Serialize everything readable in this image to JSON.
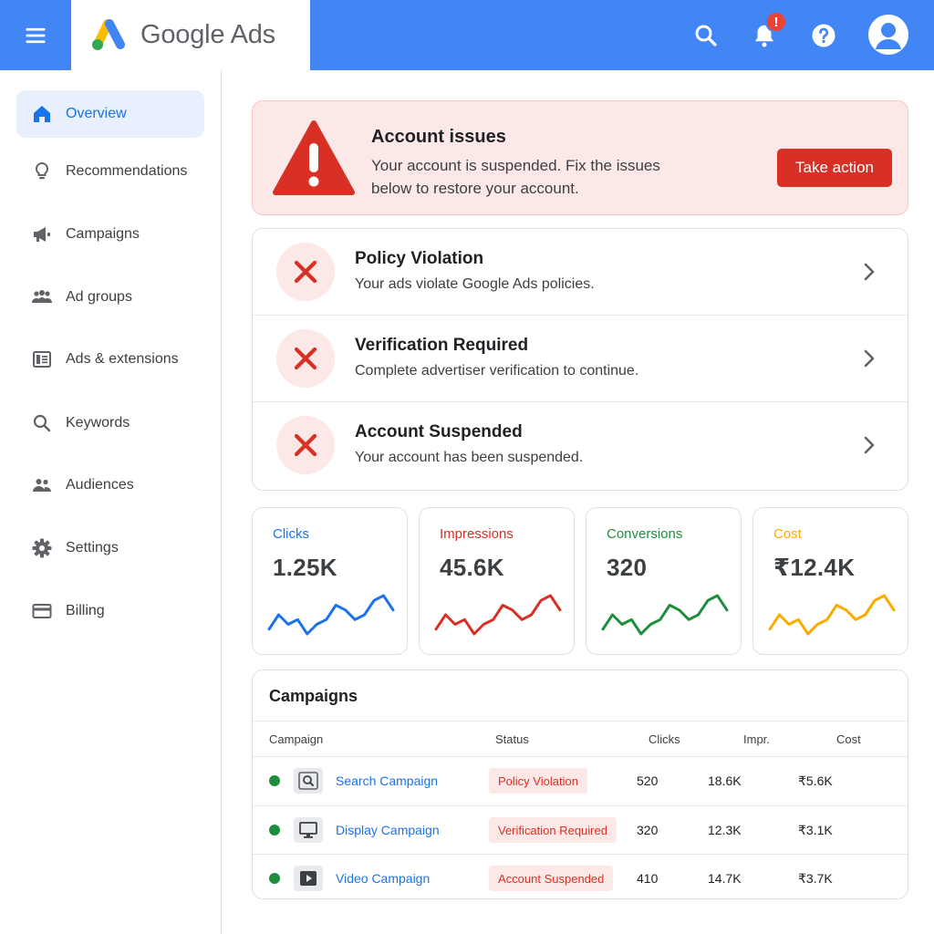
{
  "app": {
    "name": "Google Ads"
  },
  "colors": {
    "brand_blue": "#4285f4",
    "link_blue": "#1a73e8",
    "error_red": "#d93025",
    "success_green": "#1e8e3e",
    "warning_yellow": "#fbbc04"
  },
  "header": {
    "notification_badge": "!",
    "icons": [
      "menu-icon",
      "search-icon",
      "bell-icon",
      "help-icon",
      "account-icon"
    ]
  },
  "sidebar": {
    "items": [
      {
        "label": "Overview",
        "icon": "home-icon",
        "active": true
      },
      {
        "label": "Recommendations",
        "icon": "lightbulb-icon"
      },
      {
        "label": "Campaigns",
        "icon": "megaphone-icon"
      },
      {
        "label": "Ad groups",
        "icon": "groups-icon"
      },
      {
        "label": "Ads & extensions",
        "icon": "ads-icon"
      },
      {
        "label": "Keywords",
        "icon": "search-icon"
      },
      {
        "label": "Audiences",
        "icon": "people-icon"
      },
      {
        "label": "Settings",
        "icon": "gear-icon"
      },
      {
        "label": "Billing",
        "icon": "card-icon"
      }
    ]
  },
  "alert": {
    "title": "Account issues",
    "message": "Your account is suspended. Fix the issues below to restore your account.",
    "action_label": "Take action"
  },
  "issues": [
    {
      "title": "Policy Violation",
      "description": "Your ads violate Google Ads policies."
    },
    {
      "title": "Verification Required",
      "description": "Complete advertiser verification to continue."
    },
    {
      "title": "Account Suspended",
      "description": "Your account has been suspended."
    }
  ],
  "stats": [
    {
      "label": "Clicks",
      "value": "1.25K",
      "color": "#1a73e8",
      "trend": [
        3,
        6,
        4,
        5,
        2,
        4,
        5,
        8,
        7,
        5,
        6,
        9,
        10,
        7
      ]
    },
    {
      "label": "Impressions",
      "value": "45.6K",
      "color": "#d93025",
      "trend": [
        3,
        6,
        4,
        5,
        2,
        4,
        5,
        8,
        7,
        5,
        6,
        9,
        10,
        7
      ]
    },
    {
      "label": "Conversions",
      "value": "320",
      "color": "#1e8e3e",
      "trend": [
        3,
        6,
        4,
        5,
        2,
        4,
        5,
        8,
        7,
        5,
        6,
        9,
        10,
        7
      ]
    },
    {
      "label": "Cost",
      "value": "₹12.4K",
      "color": "#f9ab00",
      "trend": [
        3,
        6,
        4,
        5,
        2,
        4,
        5,
        8,
        7,
        5,
        6,
        9,
        10,
        7
      ]
    }
  ],
  "campaigns": {
    "title": "Campaigns",
    "columns": {
      "campaign": "Campaign",
      "status": "Status",
      "clicks": "Clicks",
      "impr": "Impr.",
      "cost": "Cost"
    },
    "rows": [
      {
        "type_icon": "search-campaign-icon",
        "name": "Search Campaign",
        "status": "Policy Violation",
        "clicks": "520",
        "impr": "18.6K",
        "cost": "₹5.6K"
      },
      {
        "type_icon": "display-campaign-icon",
        "name": "Display Campaign",
        "status": "Verification Required",
        "clicks": "320",
        "impr": "12.3K",
        "cost": "₹3.1K"
      },
      {
        "type_icon": "video-campaign-icon",
        "name": "Video Campaign",
        "status": "Account Suspended",
        "clicks": "410",
        "impr": "14.7K",
        "cost": "₹3.7K"
      }
    ]
  }
}
